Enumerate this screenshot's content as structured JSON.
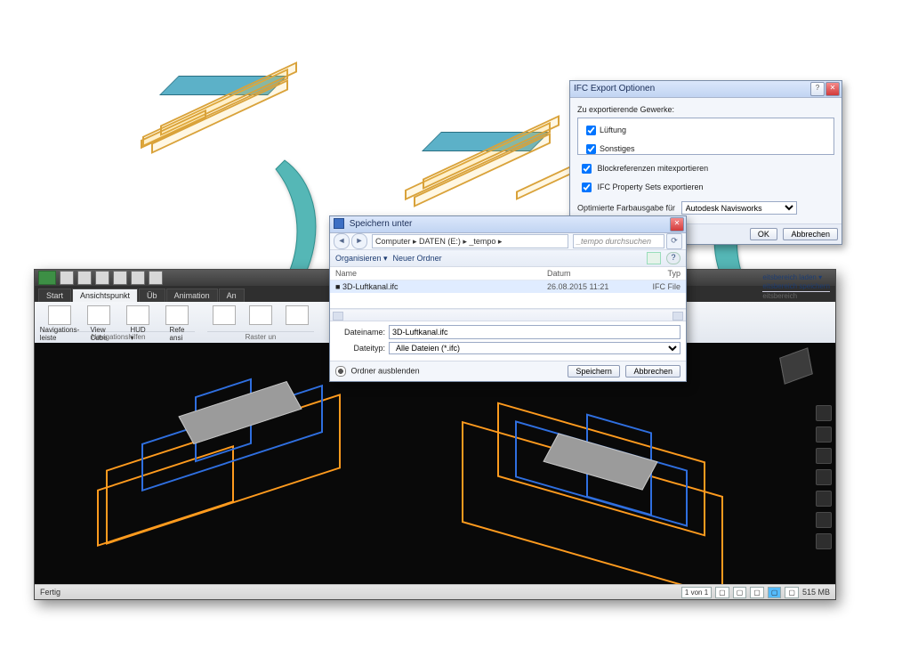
{
  "ifc_dialog": {
    "title": "IFC Export Optionen",
    "section_label": "Zu exportierende Gewerke:",
    "options": {
      "luftung": "Lüftung",
      "sonstiges": "Sonstiges"
    },
    "block_refs": "Blockreferenzen mitexportieren",
    "psets": "IFC Property Sets exportieren",
    "color_label": "Optimierte Farbausgabe für",
    "color_value": "Autodesk Navisworks",
    "ok": "OK",
    "cancel": "Abbrechen"
  },
  "save_dialog": {
    "title": "Speichern unter",
    "path": "Computer  ▸  DATEN (E:)  ▸  _tempo  ▸",
    "search_placeholder": "_tempo durchsuchen",
    "organize": "Organisieren ▾",
    "new_folder": "Neuer Ordner",
    "col_name": "Name",
    "col_date": "Datum",
    "col_type": "Typ",
    "file_name": "3D-Luftkanal.ifc",
    "file_date": "26.08.2015 11:21",
    "file_type": "IFC File",
    "label_filename": "Dateiname:",
    "field_filename": "3D-Luftkanal.ifc",
    "label_filetype": "Dateityp:",
    "field_filetype": "Alle Dateien (*.ifc)",
    "hide_folders": "Ordner ausblenden",
    "save": "Speichern",
    "cancel": "Abbrechen"
  },
  "viewer": {
    "tabs": {
      "start": "Start",
      "view": "Ansichtspunkt",
      "ub": "Üb",
      "anim": "Animation",
      "an": "An"
    },
    "ribbon": {
      "nav_leiste": "Navigations-\nleiste",
      "view_cube": "View\nCube",
      "hud": "HUD\n▾",
      "ref": "Refe\nansi",
      "group_nav": "Navigationshilfen",
      "group_raster": "Raster un",
      "workspace_load": "eitsbereich laden ▾",
      "workspace_save": "eitsbereich speichern",
      "workspace_grp": "eitsbereich"
    },
    "status": {
      "ready": "Fertig",
      "sheet": "1 von 1",
      "mem": "515 MB"
    }
  }
}
